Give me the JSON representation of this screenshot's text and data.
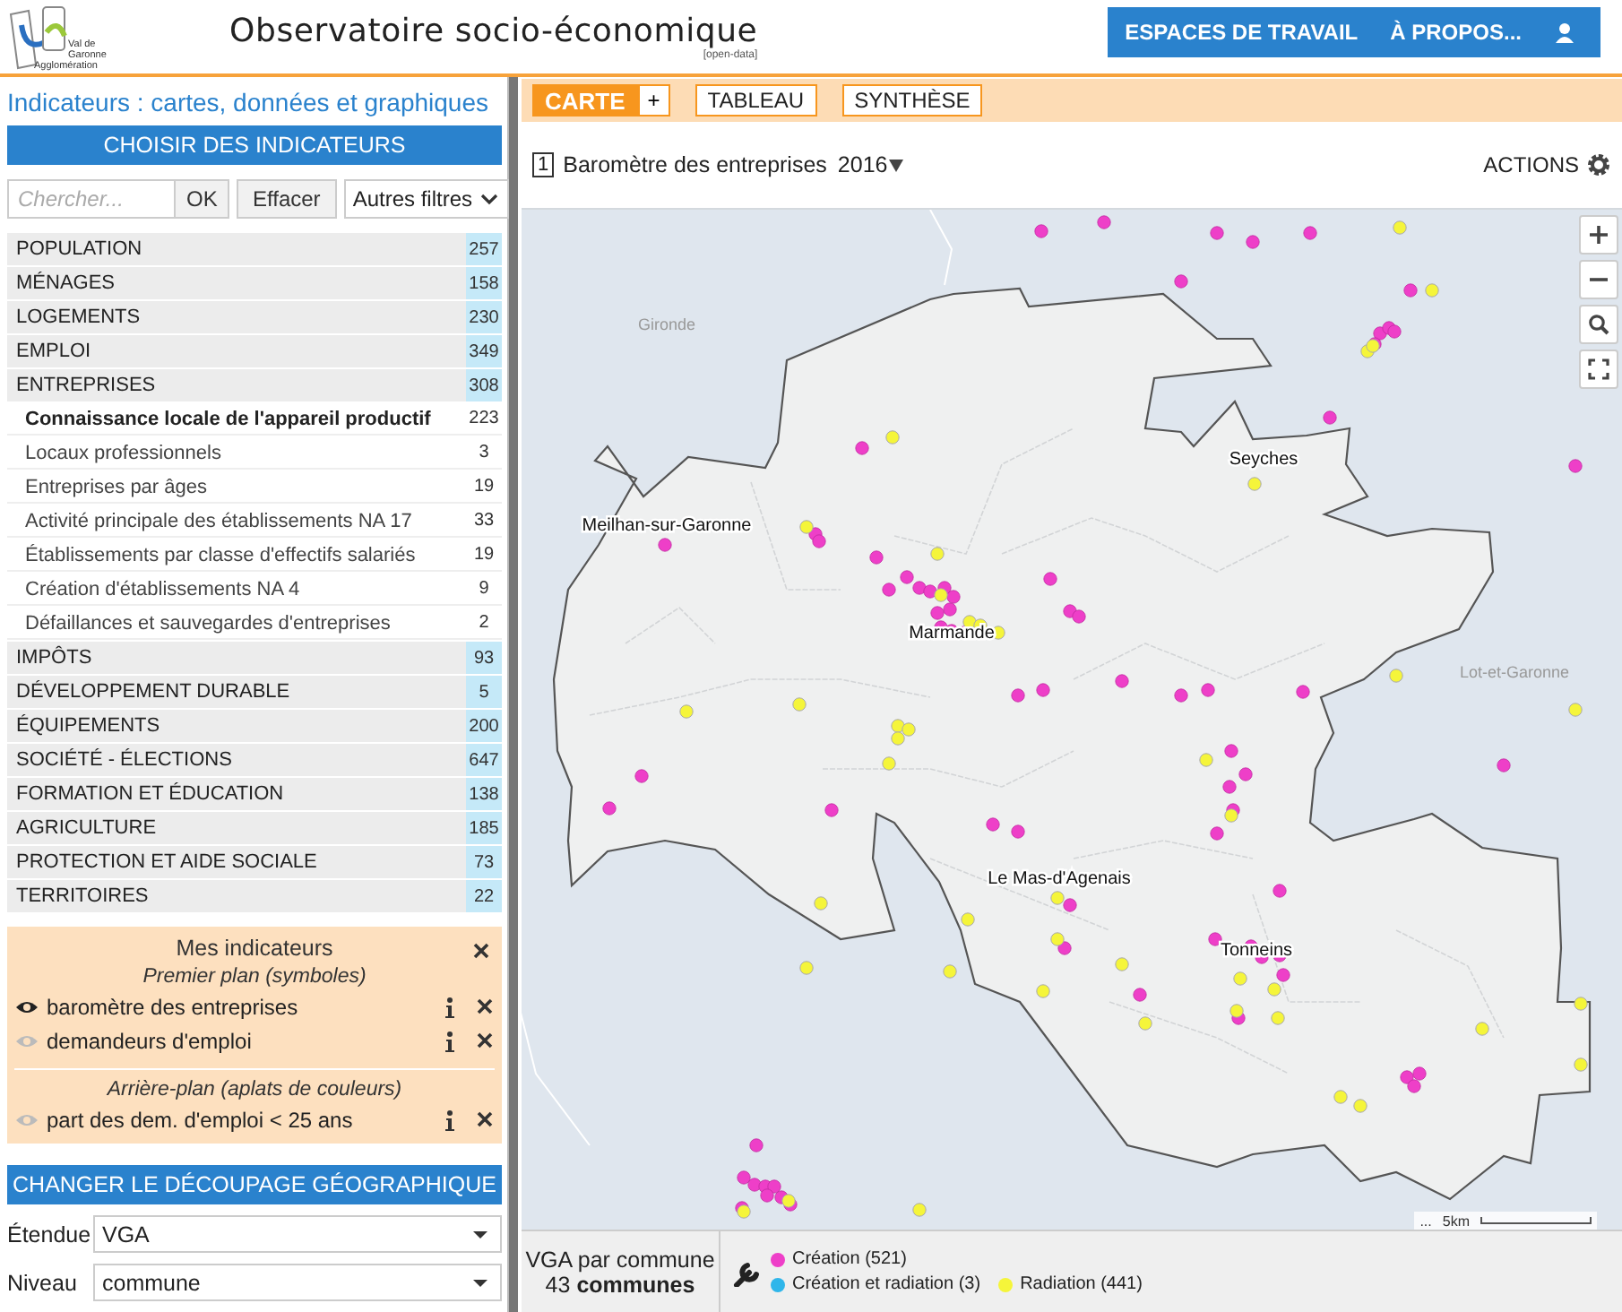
{
  "header": {
    "logo_text": [
      "Val de",
      "Garonne",
      "Agglomération"
    ],
    "title": "Observatoire socio-économique",
    "subtitle": "[open-data]",
    "nav": [
      "ESPACES DE TRAVAIL",
      "À PROPOS..."
    ]
  },
  "sidebar": {
    "heading": "Indicateurs : cartes, données et graphiques",
    "choose_button": "CHOISIR DES INDICATEURS",
    "search": {
      "placeholder": "Chercher...",
      "ok": "OK",
      "clear": "Effacer",
      "filters": "Autres filtres"
    },
    "categories": [
      {
        "label": "POPULATION",
        "count": "257"
      },
      {
        "label": "MÉNAGES",
        "count": "158"
      },
      {
        "label": "LOGEMENTS",
        "count": "230"
      },
      {
        "label": "EMPLOI",
        "count": "349"
      },
      {
        "label": "ENTREPRISES",
        "count": "308",
        "children": [
          {
            "label": "Connaissance locale de l'appareil productif",
            "count": "223",
            "kind": "group"
          },
          {
            "label": "Locaux professionnels",
            "count": "3",
            "kind": "item"
          },
          {
            "label": "Entreprises par âges",
            "count": "19",
            "kind": "item"
          },
          {
            "label": "Activité principale des établissements NA 17",
            "count": "33",
            "kind": "item"
          },
          {
            "label": "Établissements par classe d'effectifs salariés",
            "count": "19",
            "kind": "item"
          },
          {
            "label": "Création d'établissements NA 4",
            "count": "9",
            "kind": "item"
          },
          {
            "label": "Défaillances et sauvegardes d'entreprises",
            "count": "2",
            "kind": "item"
          }
        ]
      },
      {
        "label": "IMPÔTS",
        "count": "93"
      },
      {
        "label": "DÉVELOPPEMENT DURABLE",
        "count": "5"
      },
      {
        "label": "ÉQUIPEMENTS",
        "count": "200"
      },
      {
        "label": "SOCIÉTÉ - ÉLECTIONS",
        "count": "647"
      },
      {
        "label": "FORMATION ET ÉDUCATION",
        "count": "138"
      },
      {
        "label": "AGRICULTURE",
        "count": "185"
      },
      {
        "label": "PROTECTION ET AIDE SOCIALE",
        "count": "73"
      },
      {
        "label": "TERRITOIRES",
        "count": "22"
      }
    ],
    "my_indicators": {
      "title": "Mes indicateurs",
      "sections": [
        {
          "title": "Premier plan (symboles)",
          "items": [
            {
              "label": "baromètre des entreprises",
              "visible": true
            },
            {
              "label": "demandeurs d'emploi",
              "visible": false
            }
          ]
        },
        {
          "title": "Arrière-plan (aplats de couleurs)",
          "items": [
            {
              "label": "part des dem. d'emploi < 25 ans",
              "visible": false
            }
          ]
        }
      ]
    },
    "geo_button": "CHANGER LE DÉCOUPAGE GÉOGRAPHIQUE",
    "selects": [
      {
        "label": "Étendue",
        "value": "VGA"
      },
      {
        "label": "Niveau",
        "value": "commune"
      }
    ]
  },
  "tabs": [
    {
      "label": "CARTE",
      "selected": true,
      "add": "+"
    },
    {
      "label": "TABLEAU",
      "selected": false
    },
    {
      "label": "SYNTHÈSE",
      "selected": false
    }
  ],
  "map": {
    "number": "1",
    "title": "Baromètre des entreprises",
    "year": "2016",
    "actions": "ACTIONS",
    "labels": [
      {
        "text": "Gironde",
        "kind": "region"
      },
      {
        "text": "Meilhan-sur-Garonne",
        "kind": "commune"
      },
      {
        "text": "Seyches",
        "kind": "commune"
      },
      {
        "text": "Marmande",
        "kind": "commune"
      },
      {
        "text": "Lot-et-Garonne",
        "kind": "region"
      },
      {
        "text": "Le Mas-d'Agenais",
        "kind": "commune"
      },
      {
        "text": "Tonneins",
        "kind": "commune"
      }
    ],
    "attribution": "...",
    "scale": "5km"
  },
  "footer": {
    "scope": "VGA par commune",
    "count": "43",
    "count_unit": "communes",
    "legend": [
      {
        "label": "Création (521)",
        "color": "#ee3fc8"
      },
      {
        "label": "Création et radiation (3)",
        "color": "#2fb6ea"
      },
      {
        "label": "Radiation (441)",
        "color": "#f5f53a"
      }
    ]
  }
}
